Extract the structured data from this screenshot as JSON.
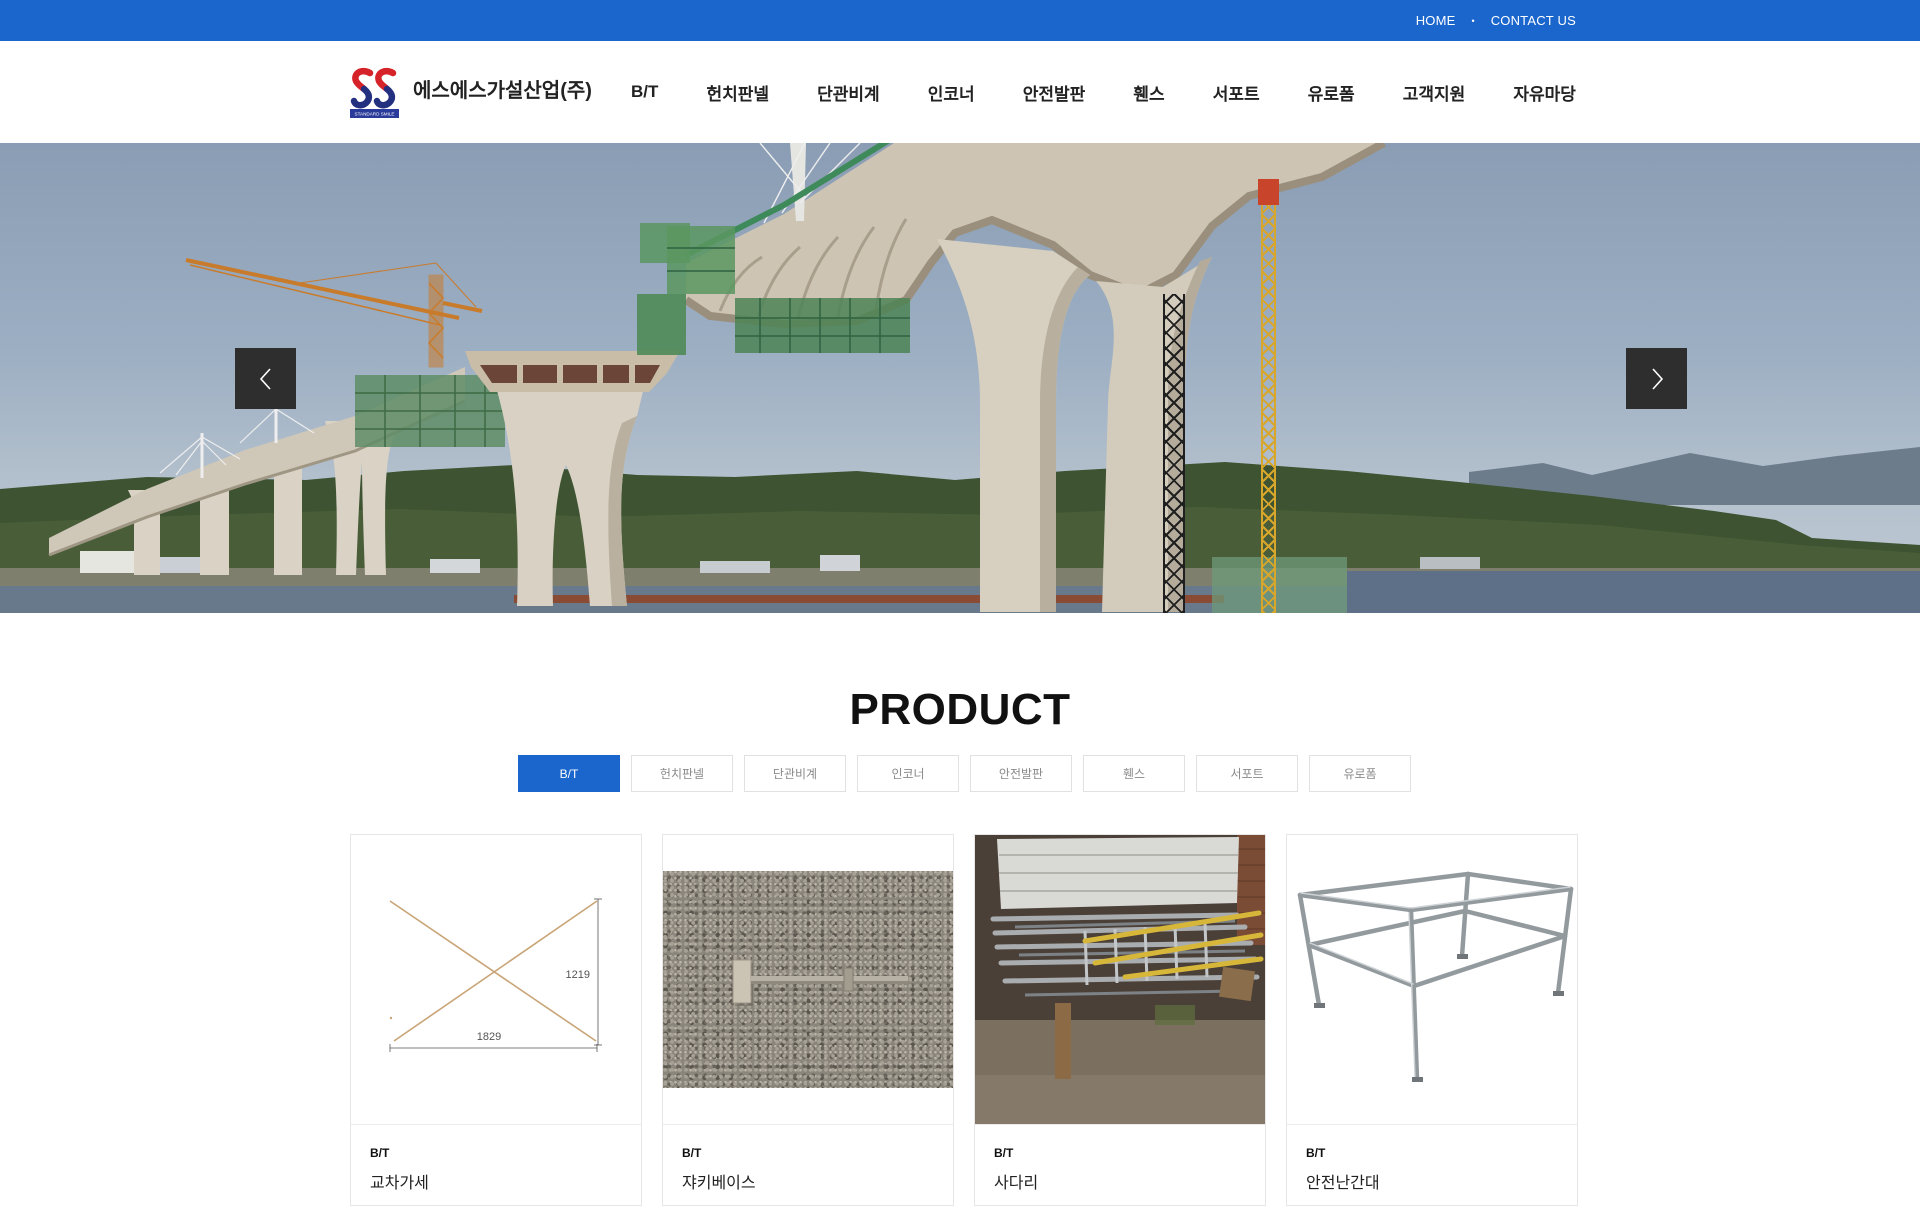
{
  "topbar": {
    "home": "HOME",
    "separator": "•",
    "contact": "CONTACT US"
  },
  "brand": {
    "name": "에스에스가설산업(주)",
    "logo_caption": "STANDARD SMILE"
  },
  "nav": {
    "items": [
      "B/T",
      "헌치판넬",
      "단관비계",
      "인코너",
      "안전발판",
      "휀스",
      "서포트",
      "유로폼",
      "고객지원",
      "자유마당"
    ]
  },
  "hero": {
    "prev_icon": "chevron-left-icon",
    "next_icon": "chevron-right-icon"
  },
  "product": {
    "title": "PRODUCT",
    "active_tab": "B/T",
    "tabs": [
      "B/T",
      "헌치판넬",
      "단관비계",
      "인코너",
      "안전발판",
      "휀스",
      "서포트",
      "유로폼"
    ],
    "cards": [
      {
        "category": "B/T",
        "name": "교차가세",
        "diagram_labels": {
          "height": "1219",
          "width": "1829"
        }
      },
      {
        "category": "B/T",
        "name": "쟈키베이스"
      },
      {
        "category": "B/T",
        "name": "사다리"
      },
      {
        "category": "B/T",
        "name": "안전난간대"
      }
    ]
  },
  "colors": {
    "primary": "#1b66cc",
    "nav_text": "#222222",
    "tab_inactive_text": "#8a8a8a",
    "slider_button": "#2e2e2e",
    "logo_red": "#d6232a",
    "logo_navy": "#23307f"
  }
}
